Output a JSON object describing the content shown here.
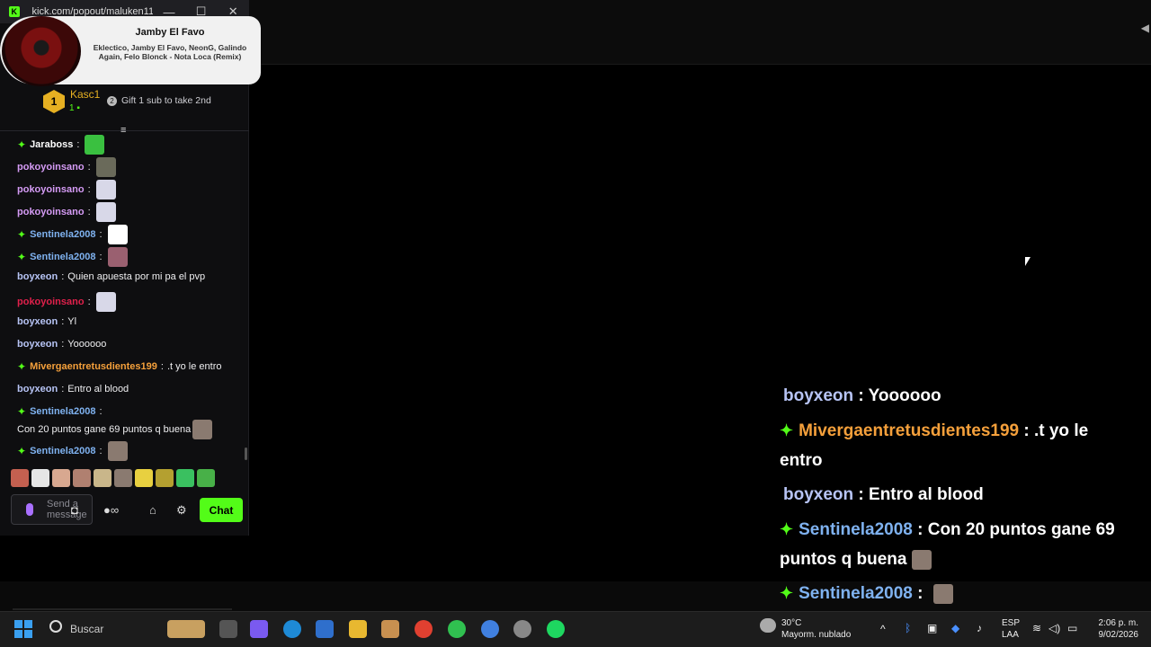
{
  "window": {
    "url": "kick.com/popout/maluken11...",
    "min": "—",
    "max": "☐",
    "close": "✕"
  },
  "now_playing": {
    "title": "Jamby El Favo",
    "artists": "Eklectico, Jamby El Favo, NeonG, Galindo Again, Felo Blonck - Nota Loca (Remix)"
  },
  "gifter": {
    "rank": "1",
    "name": "Kasc1",
    "count": "1",
    "cta": "Gift 1 sub to take 2nd"
  },
  "messages": [
    {
      "user": "Jaraboss",
      "color": "#ffffff",
      "badge": true,
      "text": ""
    },
    {
      "user": "pokoyoinsano",
      "color": "#d59bf5",
      "badge": false,
      "text": ""
    },
    {
      "user": "pokoyoinsano",
      "color": "#d59bf5",
      "badge": false,
      "text": ""
    },
    {
      "user": "pokoyoinsano",
      "color": "#d59bf5",
      "badge": false,
      "text": ""
    },
    {
      "user": "Sentinela2008",
      "color": "#7fb2f0",
      "badge": true,
      "text": ""
    },
    {
      "user": "Sentinela2008",
      "color": "#7fb2f0",
      "badge": true,
      "text": ""
    },
    {
      "user": "boyxeon",
      "color": "#b7c4f5",
      "badge": false,
      "text": "Quien apuesta por mi pa el pvp"
    },
    {
      "user": "pokoyoinsano",
      "color": "#e0204b",
      "badge": false,
      "text": ""
    },
    {
      "user": "boyxeon",
      "color": "#b7c4f5",
      "badge": false,
      "text": "Yl"
    },
    {
      "user": "boyxeon",
      "color": "#b7c4f5",
      "badge": false,
      "text": "Yoooooo"
    },
    {
      "user": "Mivergaentretusdientes199",
      "color": "#f5a03b",
      "badge": true,
      "text": ".t yo le entro"
    },
    {
      "user": "boyxeon",
      "color": "#b7c4f5",
      "badge": false,
      "text": "Entro al blood"
    },
    {
      "user": "Sentinela2008",
      "color": "#7fb2f0",
      "badge": true,
      "text": "Con 20 puntos gane 69 puntos q buena"
    },
    {
      "user": "Sentinela2008",
      "color": "#7fb2f0",
      "badge": true,
      "text": ""
    }
  ],
  "input": {
    "placeholder": "Send a message",
    "chat_button": "Chat"
  },
  "overlay": [
    {
      "user": "boyxeon",
      "color": "#b7c4f5",
      "badge": false,
      "text": "Yoooooo"
    },
    {
      "user": "Mivergaentretusdientes199",
      "color": "#f5a03b",
      "badge": true,
      "text": ".t yo le entro"
    },
    {
      "user": "boyxeon",
      "color": "#b7c4f5",
      "badge": false,
      "text": "Entro al blood"
    },
    {
      "user": "Sentinela2008",
      "color": "#7fb2f0",
      "badge": true,
      "text": "Con 20 puntos gane 69 puntos q buena"
    },
    {
      "user": "Sentinela2008",
      "color": "#7fb2f0",
      "badge": true,
      "text": ""
    }
  ],
  "taskbar": {
    "search": "Buscar",
    "weather_temp": "30°C",
    "weather_desc": "Mayorm. nublado",
    "lang": "ESP",
    "lang2": "LAA",
    "time": "2:06 p. m.",
    "date": "9/02/2026"
  },
  "colors": {
    "kick_green": "#53fc18"
  }
}
